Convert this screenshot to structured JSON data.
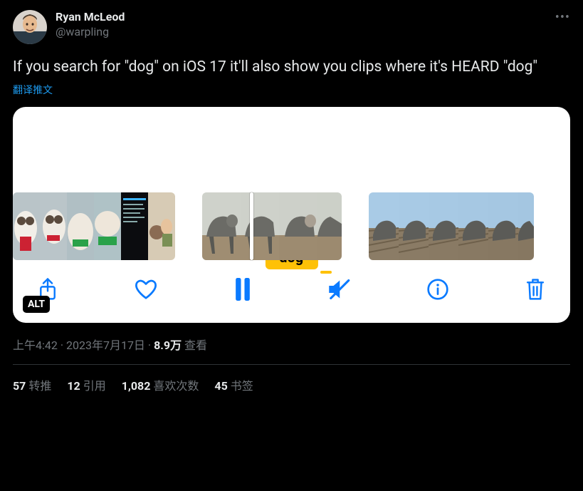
{
  "author": {
    "display_name": "Ryan McLeod",
    "handle": "@warpling"
  },
  "tweet_text": "If you search for \"dog\" on iOS 17 it'll also show you clips where it's HEARD \"dog\"",
  "translate_label": "翻译推文",
  "media": {
    "caption_badge": "\"dog\"",
    "alt_badge": "ALT"
  },
  "timestamp": {
    "time": "上午4:42",
    "date": "2023年7月17日",
    "views_count": "8.9万",
    "views_label": "查看"
  },
  "stats": {
    "retweets": {
      "count": "57",
      "label": "转推"
    },
    "quotes": {
      "count": "12",
      "label": "引用"
    },
    "likes": {
      "count": "1,082",
      "label": "喜欢次数"
    },
    "bookmarks": {
      "count": "45",
      "label": "书签"
    }
  }
}
